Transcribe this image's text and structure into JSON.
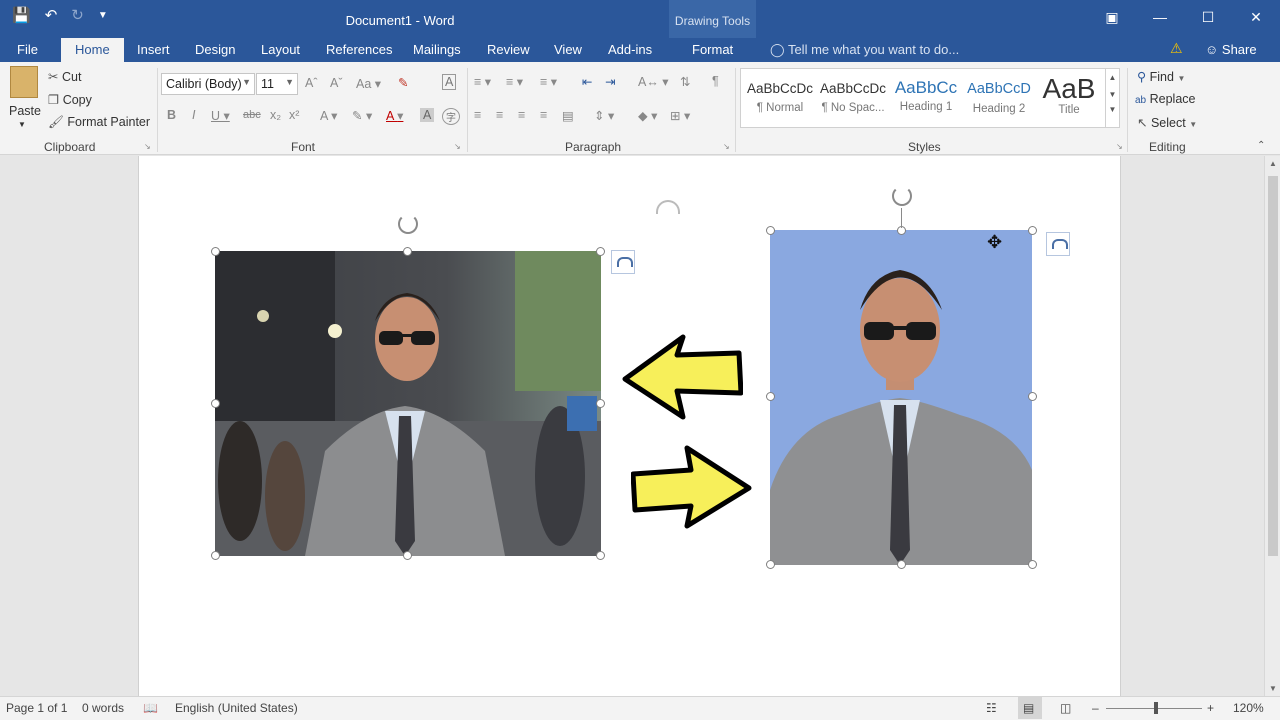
{
  "app": {
    "title": "Document1 - Word",
    "contextual_group": "Drawing Tools"
  },
  "tabs": [
    {
      "label": "File"
    },
    {
      "label": "Home"
    },
    {
      "label": "Insert"
    },
    {
      "label": "Design"
    },
    {
      "label": "Layout"
    },
    {
      "label": "References"
    },
    {
      "label": "Mailings"
    },
    {
      "label": "Review"
    },
    {
      "label": "View"
    },
    {
      "label": "Add-ins"
    },
    {
      "label": "Format"
    }
  ],
  "tell_me": "Tell me what you want to do...",
  "share_label": "Share",
  "ribbon": {
    "clipboard": {
      "label": "Clipboard",
      "paste": "Paste",
      "cut": "Cut",
      "copy": "Copy",
      "format_painter": "Format Painter"
    },
    "font": {
      "label": "Font",
      "family": "Calibri (Body)",
      "size": "11"
    },
    "paragraph": {
      "label": "Paragraph"
    },
    "styles": {
      "label": "Styles",
      "items": [
        {
          "preview": "AaBbCcDc",
          "name": "¶ Normal"
        },
        {
          "preview": "AaBbCcDc",
          "name": "¶ No Spac..."
        },
        {
          "preview": "AaBbCc",
          "name": "Heading 1"
        },
        {
          "preview": "AaBbCcD",
          "name": "Heading 2"
        },
        {
          "preview": "AaB",
          "name": "Title"
        }
      ]
    },
    "editing": {
      "label": "Editing",
      "find": "Find",
      "replace": "Replace",
      "select": "Select"
    }
  },
  "status": {
    "page": "Page 1 of 1",
    "words": "0 words",
    "language": "English (United States)",
    "zoom": "120%"
  },
  "colors": {
    "title_bar": "#2b579a",
    "picture_background": "#8aa8e0",
    "arrow_fill": "#f7ef5a"
  }
}
